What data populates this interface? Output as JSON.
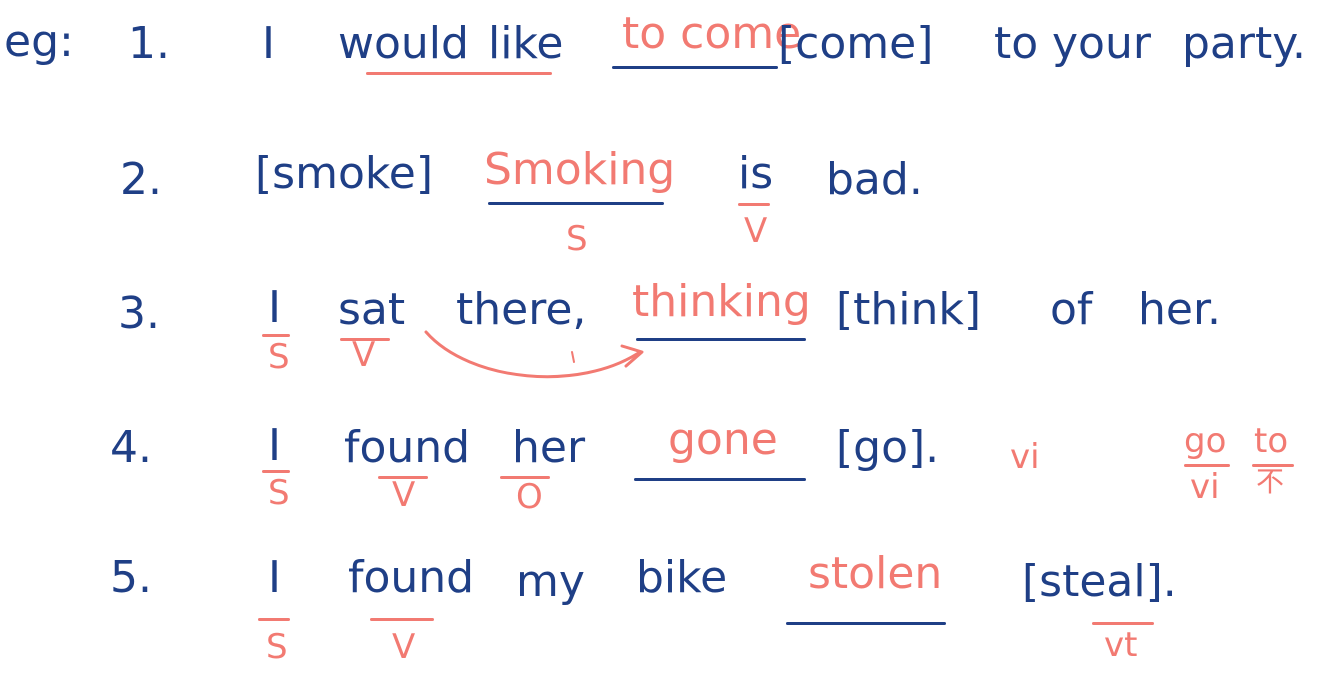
{
  "colors": {
    "ink_blue": "#1f3f86",
    "ink_red": "#f27a72"
  },
  "prefix": "eg:",
  "sentences": [
    {
      "number": "1.",
      "words": [
        "I",
        "would",
        "like",
        "to come",
        "[come]",
        "to",
        "your",
        "party."
      ]
    },
    {
      "number": "2.",
      "words": [
        "[smoke]",
        "Smoking",
        "is",
        "bad."
      ],
      "marks": [
        "S",
        "V"
      ]
    },
    {
      "number": "3.",
      "words": [
        "I",
        "sat",
        "there,",
        "thinking",
        "[think]",
        "of",
        "her."
      ],
      "marks": [
        "S",
        "V"
      ]
    },
    {
      "number": "4.",
      "words": [
        "I",
        "found",
        "her",
        "gone",
        "[go].",
        "vi"
      ],
      "marks": [
        "S",
        "V",
        "O"
      ],
      "note": {
        "top": [
          "go",
          "to"
        ],
        "bottom": [
          "vi",
          "不"
        ]
      }
    },
    {
      "number": "5.",
      "words": [
        "I",
        "found",
        "my",
        "bike",
        "stolen",
        "[steal]."
      ],
      "marks": [
        "S",
        "V",
        "vt"
      ]
    }
  ]
}
